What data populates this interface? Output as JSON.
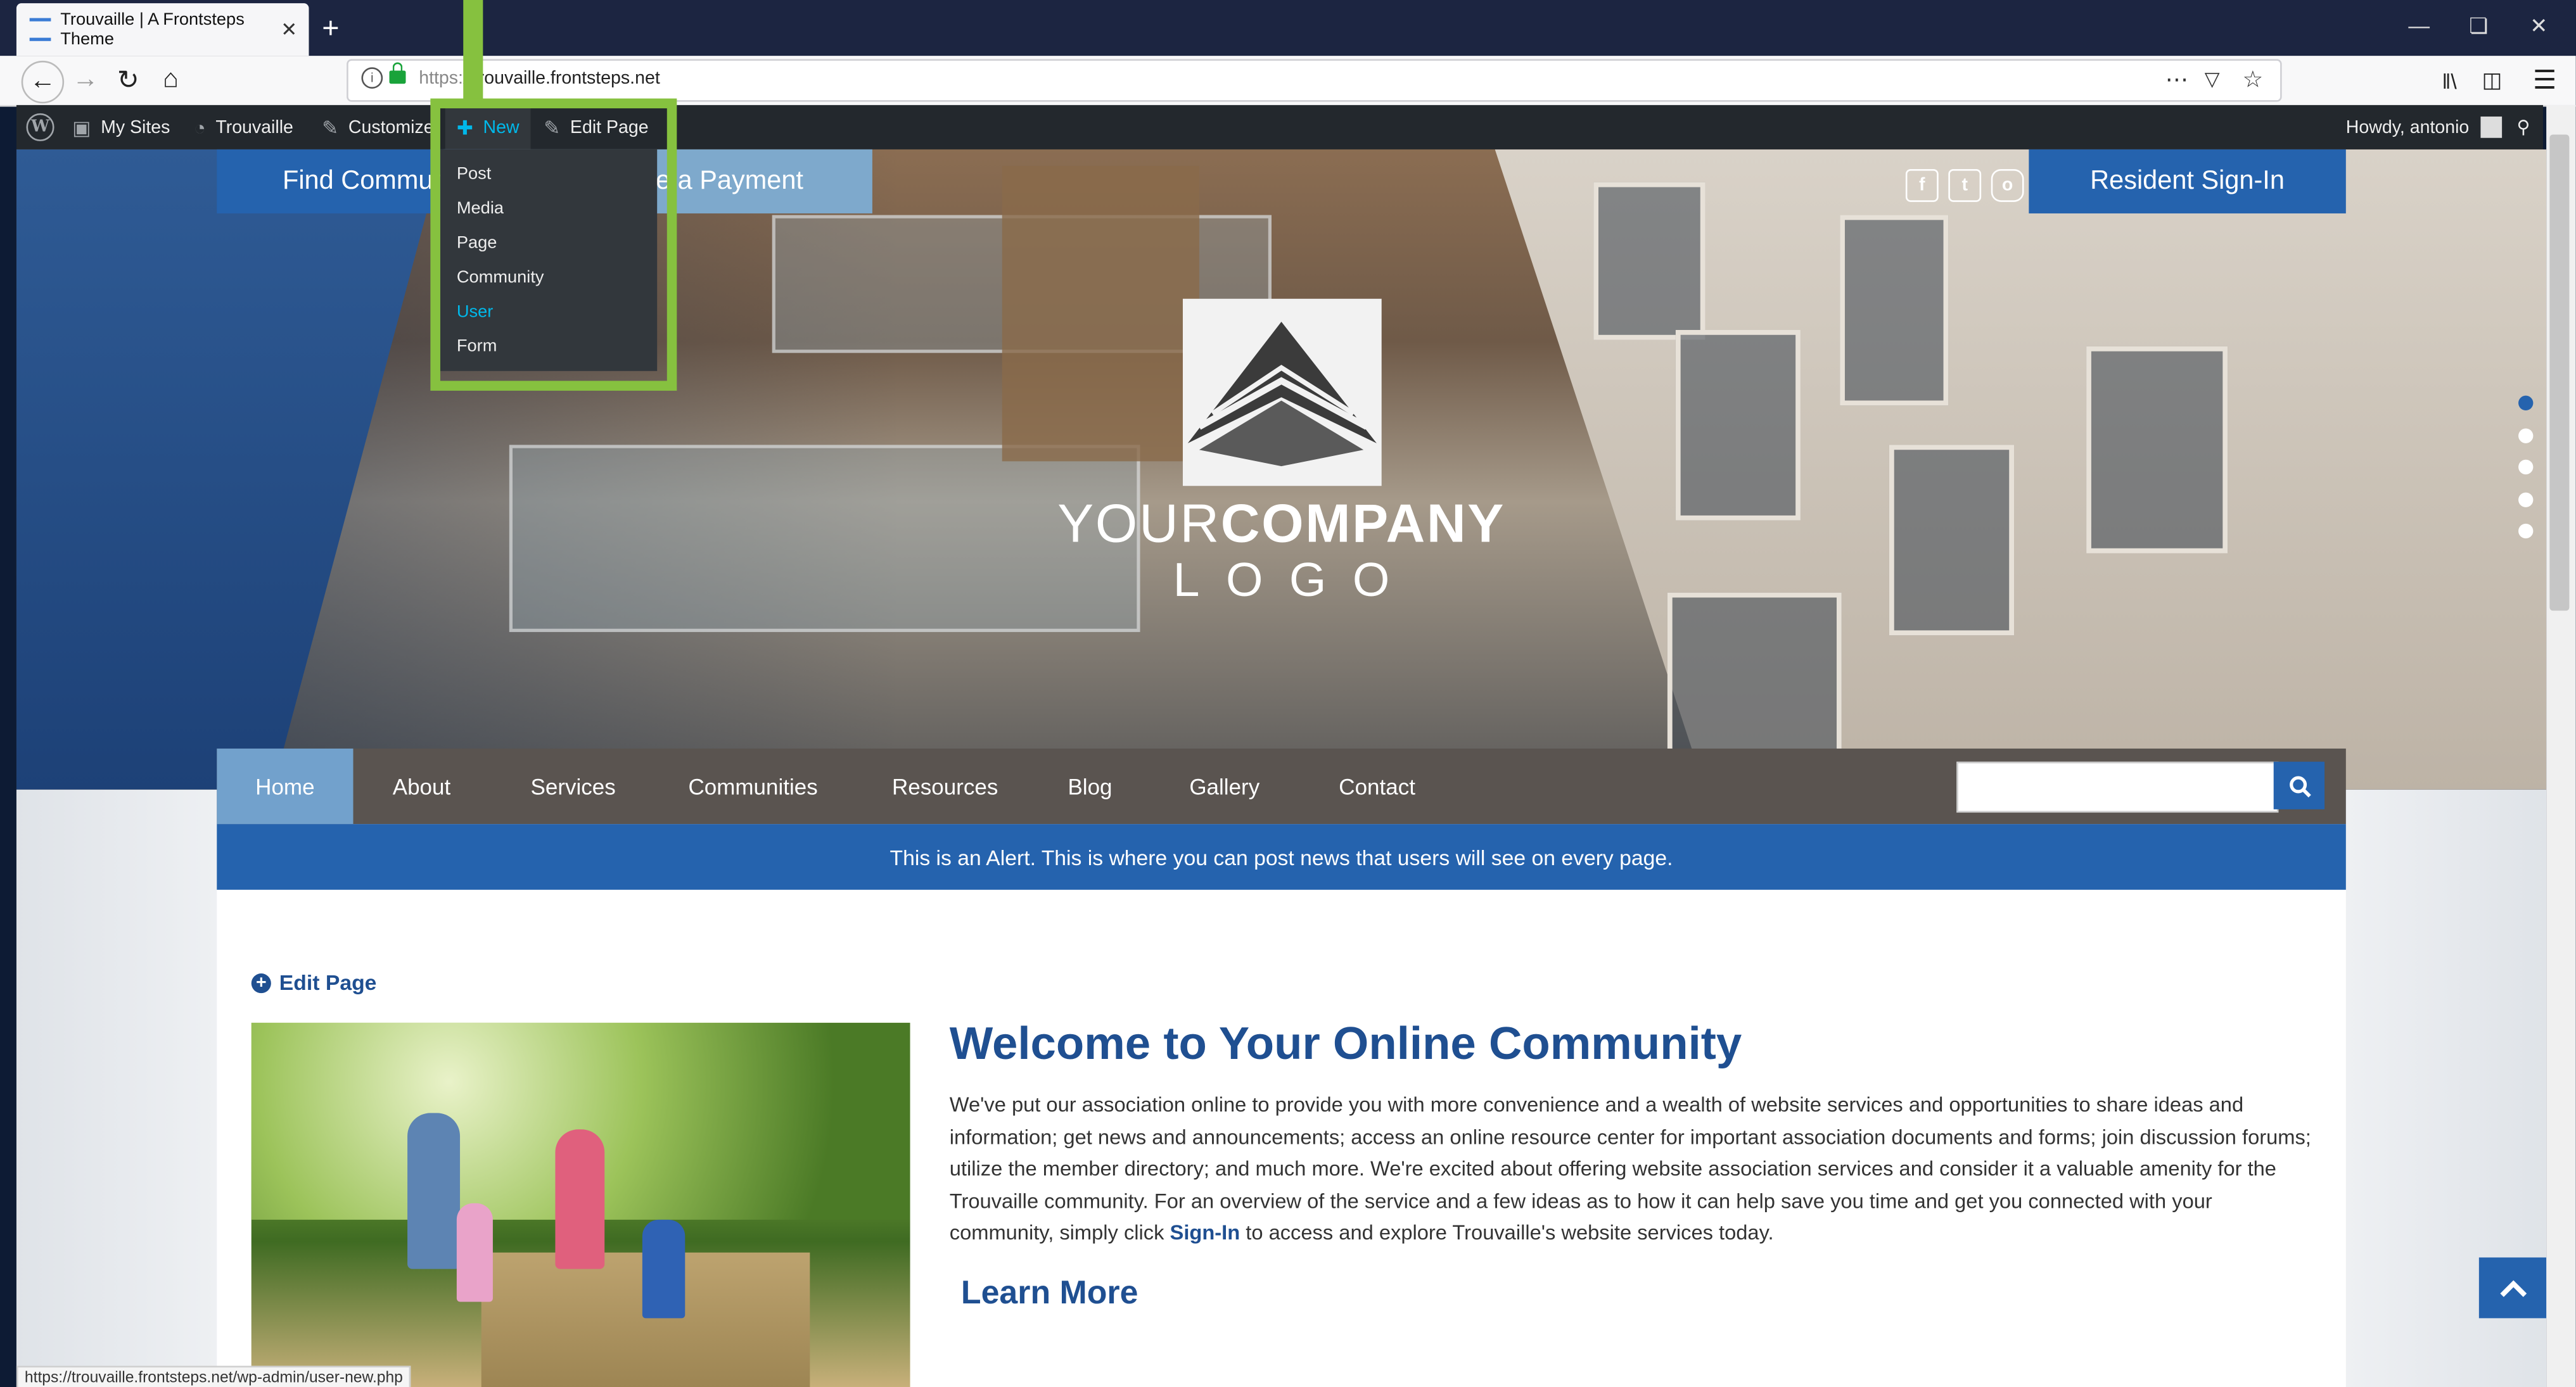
{
  "browser": {
    "tab_title": "Trouvaille | A Frontsteps Theme",
    "new_tab_symbol": "+",
    "close_symbol": "✕",
    "url_prefix": "https://",
    "url_host": "trouvaille.frontsteps.net",
    "status_url": "https://trouvaille.frontsteps.net/wp-admin/user-new.php"
  },
  "admin_bar": {
    "my_sites": "My Sites",
    "site_name": "Trouvaille",
    "customize": "Customize",
    "new": "New",
    "edit_page": "Edit Page",
    "howdy": "Howdy, antonio"
  },
  "new_menu": {
    "items": [
      "Post",
      "Media",
      "Page",
      "Community",
      "User",
      "Form"
    ],
    "active_item": "User"
  },
  "hero": {
    "find_button": "Find Community",
    "payment_button": "Make a Payment",
    "resident_button": "Resident Sign-In",
    "logo_word1": "YOUR",
    "logo_word2": "COMPANY",
    "logo_word3": "LOGO",
    "slider_count": 5,
    "slider_active": 1
  },
  "nav": {
    "items": [
      "Home",
      "About",
      "Services",
      "Communities",
      "Resources",
      "Blog",
      "Gallery",
      "Contact"
    ],
    "active": "Home",
    "search_value": ""
  },
  "alert": "This is an Alert. This is where you can post news that users will see on every page.",
  "content": {
    "edit_page_link": "Edit Page",
    "heading": "Welcome to Your Online Community",
    "paragraph_before_link": "We've put our association online to provide you with more convenience and a wealth of website services and opportunities to share ideas and information; get news and announcements; access an online resource center for important association documents and forms; join discussion forums; utilize the member directory; and much more. We're excited about offering website association services and consider it a valuable amenity for the Trouvaille community. For an overview of the service and a few ideas as to how it can help save you time and get you connected with your community, simply click",
    "link_text": "Sign-In",
    "paragraph_after_link": "to access and explore Trouvaille's website services today.",
    "learn_more": "Learn More"
  },
  "colors": {
    "primary_blue": "#2563ae",
    "highlight_green": "#86c13f",
    "admin_bar": "#23282d",
    "nav_bg": "#5a5450",
    "nav_active": "#72a1cc"
  }
}
